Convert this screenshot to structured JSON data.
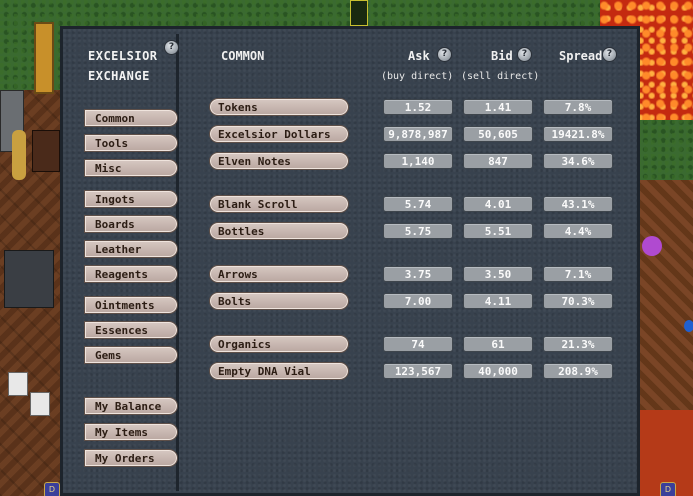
{
  "sidebar": {
    "title_line1": "EXCELSIOR",
    "title_line2": "EXCHANGE",
    "help_glyph": "?",
    "groups": [
      {
        "items": [
          "Common",
          "Tools",
          "Misc"
        ]
      },
      {
        "items": [
          "Ingots",
          "Boards",
          "Leather",
          "Reagents"
        ]
      },
      {
        "items": [
          "Ointments",
          "Essences",
          "Gems"
        ]
      },
      {
        "items": [
          "My Balance",
          "My Items",
          "My Orders"
        ]
      }
    ]
  },
  "table": {
    "category_title": "COMMON",
    "columns": {
      "ask": {
        "label": "Ask",
        "sub": "(buy direct)"
      },
      "bid": {
        "label": "Bid",
        "sub": "(sell direct)"
      },
      "spread": {
        "label": "Spread"
      }
    },
    "rows": [
      {
        "name": "Tokens",
        "ask": "1.52",
        "bid": "1.41",
        "spread": "7.8%"
      },
      {
        "name": "Excelsior Dollars",
        "ask": "9,878,987",
        "bid": "50,605",
        "spread": "19421.8%"
      },
      {
        "name": "Elven Notes",
        "ask": "1,140",
        "bid": "847",
        "spread": "34.6%"
      },
      {
        "name": "Blank Scroll",
        "ask": "5.74",
        "bid": "4.01",
        "spread": "43.1%"
      },
      {
        "name": "Bottles",
        "ask": "5.75",
        "bid": "5.51",
        "spread": "4.4%"
      },
      {
        "name": "Arrows",
        "ask": "3.75",
        "bid": "3.50",
        "spread": "7.1%"
      },
      {
        "name": "Bolts",
        "ask": "7.00",
        "bid": "4.11",
        "spread": "70.3%"
      },
      {
        "name": "Organics",
        "ask": "74",
        "bid": "61",
        "spread": "21.3%"
      },
      {
        "name": "Empty DNA Vial",
        "ask": "123,567",
        "bid": "40,000",
        "spread": "208.9%"
      }
    ]
  },
  "colors": {
    "panel": "#38424e",
    "button": "#c9b8b0",
    "value_box": "#9a9fa4"
  }
}
